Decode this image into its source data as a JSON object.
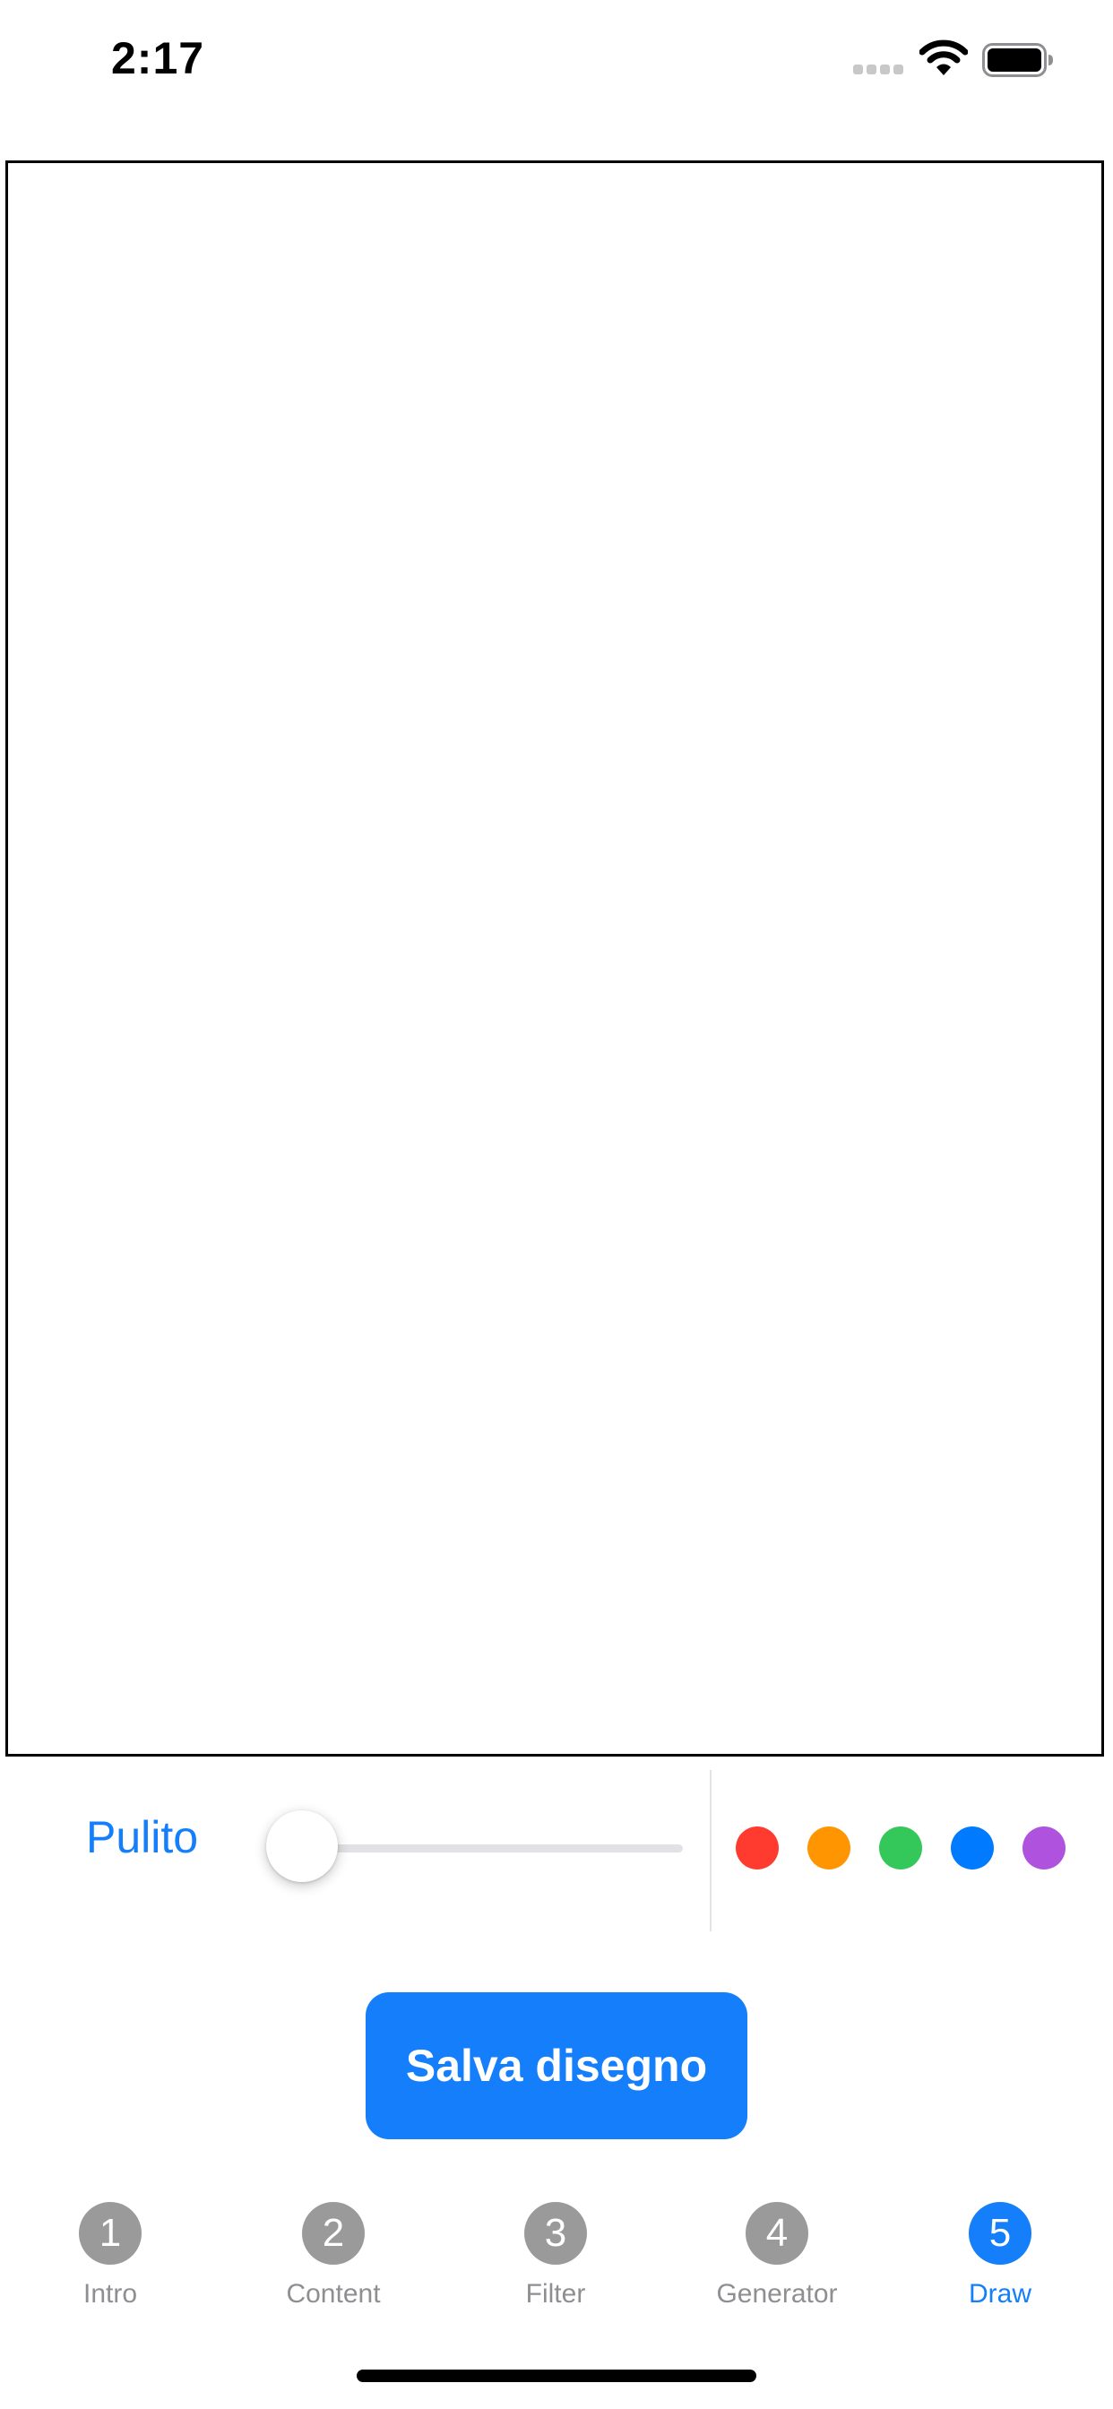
{
  "status_bar": {
    "time": "2:17",
    "signal_icon": "signal-bars-icon",
    "wifi_icon": "wifi-icon",
    "battery_icon": "battery-icon"
  },
  "canvas": {
    "border_color": "#000000"
  },
  "controls": {
    "clear_label": "Pulito",
    "stroke_width_fraction": 0.0,
    "colors": [
      {
        "name": "red",
        "hex": "#ff3b30"
      },
      {
        "name": "orange",
        "hex": "#ff9500"
      },
      {
        "name": "green",
        "hex": "#34c759"
      },
      {
        "name": "blue",
        "hex": "#007aff"
      },
      {
        "name": "purple",
        "hex": "#af52de"
      }
    ]
  },
  "save_button": {
    "label": "Salva disegno"
  },
  "tab_bar": {
    "items": [
      {
        "number": "1",
        "label": "Intro"
      },
      {
        "number": "2",
        "label": "Content"
      },
      {
        "number": "3",
        "label": "Filter"
      },
      {
        "number": "4",
        "label": "Generator"
      },
      {
        "number": "5",
        "label": "Draw"
      }
    ],
    "active_index": 4
  },
  "accent_color": "#147efb"
}
